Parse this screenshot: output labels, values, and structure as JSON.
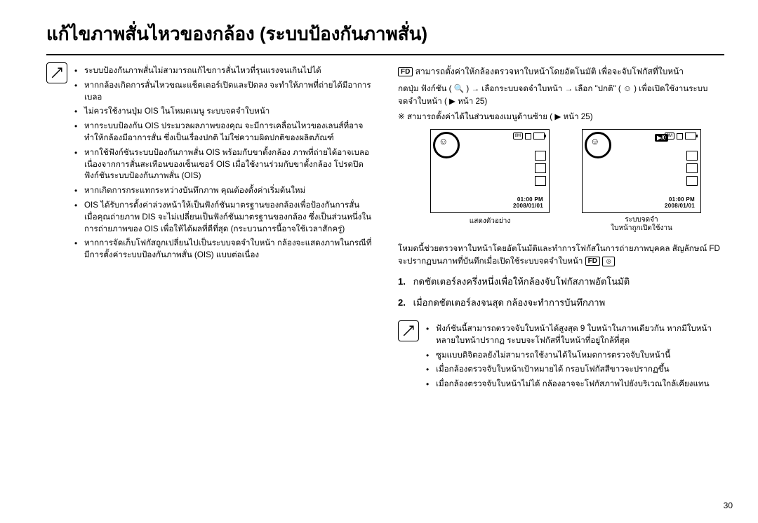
{
  "title": "แก้ไขภาพสั่นไหวของกล้อง (ระบบป้องกันภาพสั่น)",
  "left_notes": [
    "ระบบป้องกันภาพสั่นไม่สามารถแก้ไขการสั่นไหวที่รุนแรงจนเกินไปได้",
    "หากกล้องเกิดการสั่นไหวขณะแช็ตเตอร์เปิดและปิดลง จะทำให้ภาพที่ถ่ายได้มีอาการเบลอ",
    "ไม่ควรใช้งานปุ่ม OIS ในโหมดเมนู ระบบจดจำใบหน้า",
    "หากระบบป้องกัน OIS ประมวลผลภาพของคุณ จะมีการเคลื่อนไหวของเลนส์ที่อาจทำให้กล้องมีอาการสั่น ซึ่งเป็นเรื่องปกติ ไม่ใช่ความผิดปกติของผลิตภัณฑ์",
    "หากใช้ฟังก์ชันระบบป้องกันภาพสั่น OIS พร้อมกับขาตั้งกล้อง ภาพที่ถ่ายได้อาจเบลอเนื่องจากการสั่นสะเทือนของเซ็นเซอร์ OIS เมื่อใช้งานร่วมกับขาตั้งกล้อง โปรดปิดฟังก์ชันระบบป้องกันภาพสั่น (OIS)",
    "หากเกิดการกระแทกระหว่างบันทึกภาพ คุณต้องตั้งค่าเริ่มต้นใหม่",
    "OIS ได้รับการตั้งค่าล่วงหน้าให้เป็นฟังก์ชันมาตรฐานของกล้องเพื่อป้องกันการสั่น เมื่อคุณถ่ายภาพ DIS จะไม่เปลี่ยนเป็นฟังก์ชันมาตรฐานของกล้อง ซึ่งเป็นส่วนหนึ่งในการถ่ายภาพของ OIS เพื่อให้ได้ผลที่ดีที่สุด (กระบวนการนี้อาจใช้เวลาสักครู่)",
    "หากการจัดเก็บโฟกัสถูกเปลี่ยนไปเป็นระบบจดจำใบหน้า กล้องจะแสดงภาพในกรณีที่มีการตั้งค่าระบบป้องกันภาพสั่น (OIS) แบบต่อเนื่อง"
  ],
  "right_intro_1": "สามารถตั้งค่าให้กล้องตรวจหาใบหน้าโดยอัตโนมัติ เพื่อจะจับโฟกัสที่ใบหน้า",
  "right_k_line": "กดปุ่ม ฟังก์ชัน ( 🔍 ) → เลือกระบบจดจำใบหน้า → เลือก \"ปกติ\" ( ☺ ) เพื่อเปิดใช้งานระบบจดจำใบหน้า ( ▶ หน้า 25)",
  "note_prefix": "※",
  "right_star_note": "สามารถตั้งค่าได้ในส่วนของเมนูด้านซ้าย ( ▶ หน้า 25)",
  "screen_caption_left": "แสดงตัวอย่าง",
  "screen_caption_right_1": "ระบบจดจำ",
  "screen_caption_right_2": "ใบหน้าถูกเปิดใช้งาน",
  "screen_time": "01:00 PM",
  "screen_date": "2008/01/01",
  "screen_play_label": "▶/0",
  "right_more_text": "โหมดนี้ช่วยตรวจหาใบหน้าโดยอัตโนมัติและทำการโฟกัสในการถ่ายภาพบุคคล สัญลักษณ์ FD จะปรากฏบนภาพที่บันทึกเมื่อเปิดใช้ระบบจดจำใบหน้า",
  "step1": {
    "num": "1.",
    "text": "กดชัตเตอร์ลงครึ่งหนึ่งเพื่อให้กล้องจับโฟกัสภาพอัตโนมัติ"
  },
  "step2": {
    "num": "2.",
    "text": "เมื่อกดชัตเตอร์ลงจนสุด กล้องจะทำการบันทึกภาพ"
  },
  "right_notes": [
    "ฟังก์ชันนี้สามารถตรวจจับใบหน้าได้สูงสุด 9 ใบหน้าในภาพเดียวกัน หากมีใบหน้าหลายใบหน้าปรากฏ ระบบจะโฟกัสที่ใบหน้าที่อยู่ใกล้ที่สุด",
    "ซูมแบบดิจิตอลยังไม่สามารถใช้งานได้ในโหมดการตรวจจับใบหน้านี้",
    "เมื่อกล้องตรวจจับใบหน้าเป้าหมายได้ กรอบโฟกัสสีขาวจะปรากฏขึ้น",
    "เมื่อกล้องตรวจจับใบหน้าไม่ได้ กล้องอาจจะโฟกัสภาพไปยังบริเวณใกล้เคียงแทน"
  ],
  "page_number": "30",
  "fd_label": "FD",
  "mb_label": "8M"
}
